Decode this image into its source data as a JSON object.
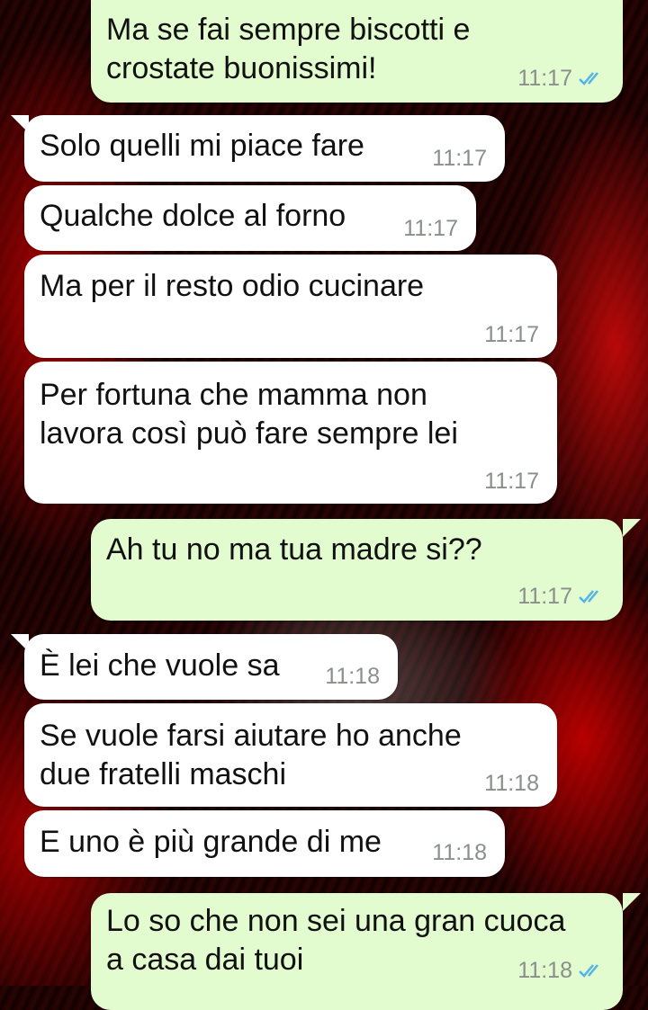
{
  "messages": [
    {
      "text": "Ma se fai sempre biscotti e\ncrostate buonissimi!",
      "time": "11:17",
      "direction": "outgoing",
      "read": true
    },
    {
      "text": "Solo quelli mi piace fare",
      "time": "11:17",
      "direction": "incoming"
    },
    {
      "text": "Qualche dolce al forno",
      "time": "11:17",
      "direction": "incoming"
    },
    {
      "text": "Ma per il resto odio cucinare",
      "time": "11:17",
      "direction": "incoming"
    },
    {
      "text": "Per fortuna che mamma non\nlavora così può fare sempre lei",
      "time": "11:17",
      "direction": "incoming"
    },
    {
      "text": "Ah tu no ma tua madre si??",
      "time": "11:17",
      "direction": "outgoing",
      "read": true
    },
    {
      "text": "È lei che vuole sa",
      "time": "11:18",
      "direction": "incoming"
    },
    {
      "text": "Se vuole farsi aiutare ho anche\ndue fratelli maschi",
      "time": "11:18",
      "direction": "incoming"
    },
    {
      "text": "E uno è più grande di me",
      "time": "11:18",
      "direction": "incoming"
    },
    {
      "text": "Lo so che non sei una gran cuoca\na casa dai tuoi",
      "time": "11:18",
      "direction": "outgoing",
      "read": true
    }
  ],
  "colors": {
    "outgoing_bubble": "#e2fbcf",
    "incoming_bubble": "#ffffff",
    "read_ticks": "#4fb6ec",
    "timestamp": "#8a8f8c"
  },
  "icons": {
    "read_receipt": "double-check-icon"
  }
}
